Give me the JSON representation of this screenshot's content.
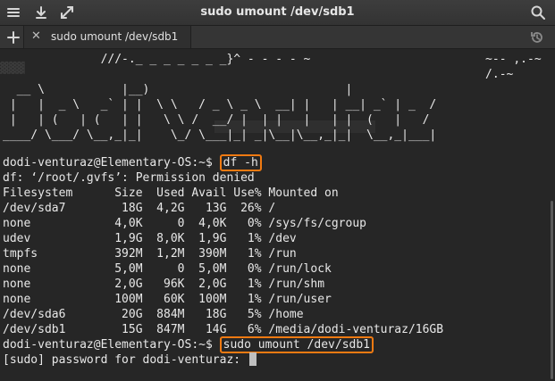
{
  "window": {
    "title": "sudo umount /dev/sdb1"
  },
  "tabs": [
    {
      "label": "sudo umount /dev/sdb1"
    }
  ],
  "ascii_art": [
    "              ///-._ _ _ _ _ _ _}^ - - - - ~                         ~-- ,.-~",
    "                                                                     /.-~",
    "  __ \\           |__)                            |",
    " |   |  _ \\   _` | |  \\ \\   / _ \\ _ \\  __| |   | __| _` | _  /",
    " |   | (   | (   | |   \\ \\ /  __/ |  | |   |   | |  (   |   /",
    "____/ \\___/ \\__,_|_|    \\_/ \\___|_| _|\\__|\\__,_|_|  \\__,_|___|"
  ],
  "terminal": {
    "prompt": "dodi-venturaz@Elementary-OS:~$ ",
    "cmd1": "df -h",
    "error": "df: ‘/root/.gvfs’: Permission denied",
    "df_header": "Filesystem      Size  Used Avail Use% Mounted on",
    "df_rows": [
      "/dev/sda7        18G  4,2G   13G  26% /",
      "none            4,0K     0  4,0K   0% /sys/fs/cgroup",
      "udev            1,9G  8,0K  1,9G   1% /dev",
      "tmpfs           392M  1,2M  390M   1% /run",
      "none            5,0M     0  5,0M   0% /run/lock",
      "none            2,0G   96K  2,0G   1% /run/shm",
      "none            100M   60K  100M   1% /run/user",
      "/dev/sda6        20G  884M   18G   5% /home",
      "/dev/sdb1        15G  847M   14G   6% /media/dodi-venturaz/16GB"
    ],
    "cmd2": "sudo umount /dev/sdb1",
    "password_prompt": "[sudo] password for dodi-venturaz: "
  },
  "icons": [
    "menu-icon",
    "download-icon",
    "fullscreen-icon",
    "search-icon",
    "new-tab-icon",
    "close-tab-icon",
    "history-icon"
  ]
}
